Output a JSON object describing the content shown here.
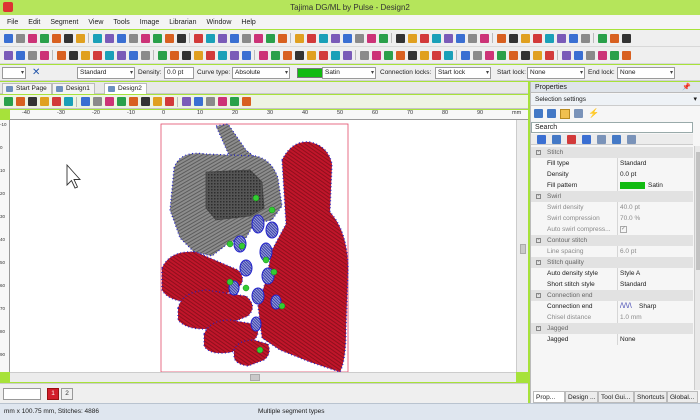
{
  "window": {
    "title": "Tajima DG/ML by Pulse - Design2"
  },
  "menu": [
    "File",
    "Edit",
    "Segment",
    "View",
    "Tools",
    "Image",
    "Librarian",
    "Window",
    "Help"
  ],
  "propbar": {
    "stitch_type": "Standard",
    "density_label": "Density:",
    "density_value": "0.0 pt",
    "curve_label": "Curve type:",
    "curve_value": "Absolute",
    "fill_value": "Satin",
    "connection_label": "Connection locks:",
    "start_value": "Start lock",
    "start_lock_label": "Start lock:",
    "start_lock_value": "None",
    "end_lock_label": "End lock:",
    "end_lock_value": "None"
  },
  "tabs": [
    {
      "label": "Start Page",
      "active": false
    },
    {
      "label": "Design1",
      "active": false
    },
    {
      "label": "Design2",
      "active": true
    }
  ],
  "ruler": {
    "h": [
      "-40",
      "-30",
      "-20",
      "-10",
      "0",
      "10",
      "20",
      "30",
      "40",
      "50",
      "60",
      "70",
      "80",
      "90",
      "mm"
    ],
    "v": [
      "-10",
      "0",
      "10",
      "20",
      "30",
      "40",
      "50",
      "60",
      "70",
      "80",
      "90"
    ]
  },
  "bottom": {
    "zoom_value": "",
    "page_btn_1": "1",
    "page_btn_2": "2"
  },
  "status": {
    "left": "mm x 100.75 mm, Stitches: 4886",
    "middle": "Multiple segment types"
  },
  "properties": {
    "title": "Properties",
    "selection": "Selection settings",
    "search_placeholder": "Search",
    "groups": [
      {
        "name": "Stitch",
        "rows": [
          {
            "name": "Fill type",
            "value": "Standard",
            "dim": false
          },
          {
            "name": "Density",
            "value": "0.0 pt",
            "dim": false
          },
          {
            "name": "Fill pattern",
            "value": "Satin",
            "dim": false,
            "swatch": "#11bb11"
          }
        ]
      },
      {
        "name": "Swirl",
        "rows": [
          {
            "name": "Swirl density",
            "value": "40.0 pt",
            "dim": true
          },
          {
            "name": "Swirl compression",
            "value": "70.0 %",
            "dim": true
          },
          {
            "name": "Auto swirl compress...",
            "value": "",
            "dim": true,
            "check": true
          }
        ]
      },
      {
        "name": "Contour stitch",
        "rows": [
          {
            "name": "Line spacing",
            "value": "6.0 pt",
            "dim": true
          }
        ]
      },
      {
        "name": "Stitch quality",
        "rows": [
          {
            "name": "Auto density style",
            "value": "Style A",
            "dim": false
          },
          {
            "name": "Short stitch style",
            "value": "Standard",
            "dim": false
          }
        ]
      },
      {
        "name": "Connection end",
        "rows": [
          {
            "name": "Connection end",
            "value": "Sharp",
            "dim": false,
            "zigzag": true
          },
          {
            "name": "Chisel distance",
            "value": "1.0 mm",
            "dim": true
          }
        ]
      },
      {
        "name": "Jagged",
        "rows": [
          {
            "name": "Jagged",
            "value": "None",
            "dim": false
          }
        ]
      }
    ],
    "bottom_tabs": [
      "Prop...",
      "Design ...",
      "Tool Gui...",
      "Shortcuts",
      "Global..."
    ]
  },
  "colors": {
    "accent_green": "#11bb11",
    "design_red": "#c0152a",
    "design_gray": "#8a8a8a",
    "node_blue": "#2222cc",
    "node_green": "#33cc33"
  }
}
